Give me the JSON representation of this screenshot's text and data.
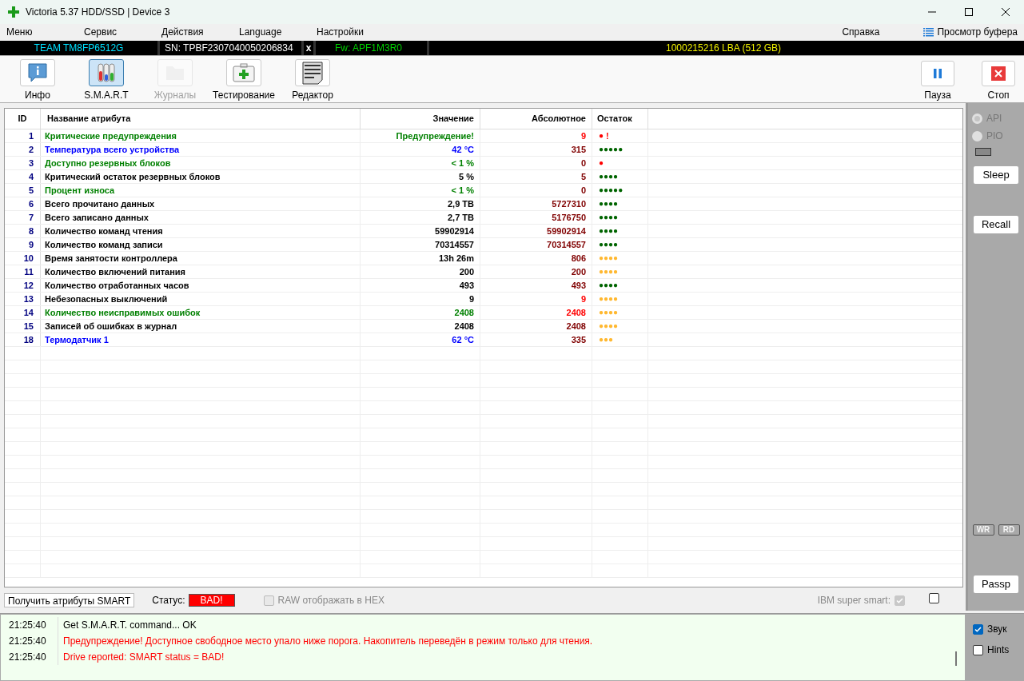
{
  "window": {
    "title": "Victoria 5.37 HDD/SSD | Device 3"
  },
  "menu": [
    {
      "label": "Меню"
    },
    {
      "label": "Сервис"
    },
    {
      "label": "Действия"
    },
    {
      "label": "Language"
    },
    {
      "label": "Настройки"
    }
  ],
  "menu_right": [
    {
      "label": "Справка",
      "kind": "text"
    },
    {
      "label": "Просмотр буфера",
      "kind": "icon"
    }
  ],
  "drive_bar": {
    "model": "TEAM TM8FP6512G",
    "serial": "SN: TPBF2307040050206834",
    "close": "x",
    "firmware": "Fw: APF1M3R0",
    "capacity": "1000215216 LBA (512 GB)"
  },
  "toolbar": [
    {
      "label": "Инфо",
      "kind": "info",
      "selected": false,
      "disabled": false
    },
    {
      "label": "S.M.A.R.T",
      "kind": "smart",
      "selected": true,
      "disabled": false
    },
    {
      "label": "Журналы",
      "kind": "logs",
      "selected": false,
      "disabled": true
    },
    {
      "label": "Тестирование",
      "kind": "test",
      "selected": false,
      "disabled": false
    },
    {
      "label": "Редактор",
      "kind": "editor",
      "selected": false,
      "disabled": false
    }
  ],
  "toolbar_right": [
    {
      "label": "Пауза",
      "kind": "pause"
    },
    {
      "label": "Стоп",
      "kind": "stop"
    }
  ],
  "table": {
    "columns": [
      "ID",
      "Название атрибута",
      "Значение",
      "Абсолютное",
      "Остаток"
    ],
    "rows": [
      {
        "id": "1",
        "name": "Критические предупреждения",
        "value": "Предупреждение!",
        "color": "#008000",
        "absolute": {
          "text": "9",
          "color": "#ff0000"
        },
        "remainder": {
          "text": "●",
          "color": "#ff0000"
        },
        "flag": "!"
      },
      {
        "id": "2",
        "name": "Температура всего устройства",
        "value": "42 °C",
        "color": "#0000ff",
        "absolute": {
          "text": "315",
          "color": "#800000"
        },
        "remainder": {
          "text": "●●●●●",
          "color": "#006400"
        }
      },
      {
        "id": "3",
        "name": "Доступно резервных блоков",
        "value": "< 1 %",
        "color": "#008000",
        "absolute": {
          "text": "0",
          "color": "#800000"
        },
        "remainder": {
          "text": "●",
          "color": "#ff0000"
        }
      },
      {
        "id": "4",
        "name": "Критический остаток резервных блоков",
        "value": "5 %",
        "color": "#000000",
        "absolute": {
          "text": "5",
          "color": "#800000"
        },
        "remainder": {
          "text": "●●●●",
          "color": "#006400"
        }
      },
      {
        "id": "5",
        "name": "Процент износа",
        "value": "< 1 %",
        "color": "#008000",
        "absolute": {
          "text": "0",
          "color": "#800000"
        },
        "remainder": {
          "text": "●●●●●",
          "color": "#006400"
        }
      },
      {
        "id": "6",
        "name": "Всего прочитано данных",
        "value": "2,9 TB",
        "color": "#000000",
        "absolute": {
          "text": "5727310",
          "color": "#800000"
        },
        "remainder": {
          "text": "●●●●",
          "color": "#006400"
        }
      },
      {
        "id": "7",
        "name": "Всего записано данных",
        "value": "2,7 TB",
        "color": "#000000",
        "absolute": {
          "text": "5176750",
          "color": "#800000"
        },
        "remainder": {
          "text": "●●●●",
          "color": "#006400"
        }
      },
      {
        "id": "8",
        "name": "Количество команд чтения",
        "value": "59902914",
        "color": "#000000",
        "absolute": {
          "text": "59902914",
          "color": "#800000"
        },
        "remainder": {
          "text": "●●●●",
          "color": "#006400"
        }
      },
      {
        "id": "9",
        "name": "Количество команд записи",
        "value": "70314557",
        "color": "#000000",
        "absolute": {
          "text": "70314557",
          "color": "#800000"
        },
        "remainder": {
          "text": "●●●●",
          "color": "#006400"
        }
      },
      {
        "id": "10",
        "name": "Время занятости контроллера",
        "value": "13h 26m",
        "color": "#000000",
        "absolute": {
          "text": "806",
          "color": "#800000"
        },
        "remainder": {
          "text": "●●●●",
          "color": "#ffb830"
        }
      },
      {
        "id": "11",
        "name": "Количество включений питания",
        "value": "200",
        "color": "#000000",
        "absolute": {
          "text": "200",
          "color": "#800000"
        },
        "remainder": {
          "text": "●●●●",
          "color": "#ffb830"
        }
      },
      {
        "id": "12",
        "name": "Количество отработанных часов",
        "value": "493",
        "color": "#000000",
        "absolute": {
          "text": "493",
          "color": "#800000"
        },
        "remainder": {
          "text": "●●●●",
          "color": "#006400"
        }
      },
      {
        "id": "13",
        "name": "Небезопасных выключений",
        "value": "9",
        "color": "#000000",
        "absolute": {
          "text": "9",
          "color": "#ff0000"
        },
        "remainder": {
          "text": "●●●●",
          "color": "#ffb830"
        }
      },
      {
        "id": "14",
        "name": "Количество неисправимых ошибок",
        "value": "2408",
        "color": "#008000",
        "absolute": {
          "text": "2408",
          "color": "#ff0000"
        },
        "remainder": {
          "text": "●●●●",
          "color": "#ffb830"
        }
      },
      {
        "id": "15",
        "name": "Записей об ошибках в журнал",
        "value": "2408",
        "color": "#000000",
        "absolute": {
          "text": "2408",
          "color": "#800000"
        },
        "remainder": {
          "text": "●●●●",
          "color": "#ffb830"
        }
      },
      {
        "id": "18",
        "name": "Термодатчик 1",
        "value": "62 °C",
        "color": "#0000ff",
        "absolute": {
          "text": "335",
          "color": "#800000"
        },
        "remainder": {
          "text": "●●●",
          "color": "#ffb830"
        }
      }
    ]
  },
  "side_panel": {
    "radios": [
      {
        "label": "API",
        "selected": true
      },
      {
        "label": "PIO",
        "selected": false
      }
    ],
    "buttons_top": [
      "Sleep",
      "Recall"
    ],
    "indicators": [
      "WR",
      "RD"
    ],
    "button_bottom": "Passp"
  },
  "bottom_bar": {
    "button": "Получить атрибуты SMART",
    "status_label": "Статус:",
    "status": "BAD!",
    "hex_option": {
      "label": "RAW отображать в HEX",
      "checked": false
    },
    "ibm_option": {
      "label": "IBM super smart:",
      "checked": true
    },
    "extra_checked": false
  },
  "log": [
    {
      "time": "21:25:40",
      "text": "Get S.M.A.R.T. command... OK",
      "color": "#000000"
    },
    {
      "time": "21:25:40",
      "text": "Предупреждение! Доступное свободное место упало ниже порога. Накопитель переведён в режим только для чтения.",
      "color": "#ff0000"
    },
    {
      "time": "21:25:40",
      "text": "Drive reported: SMART status = BAD!",
      "color": "#ff0000"
    }
  ],
  "log_options": [
    {
      "label": "Звук",
      "checked": true
    },
    {
      "label": "Hints",
      "checked": false
    }
  ]
}
